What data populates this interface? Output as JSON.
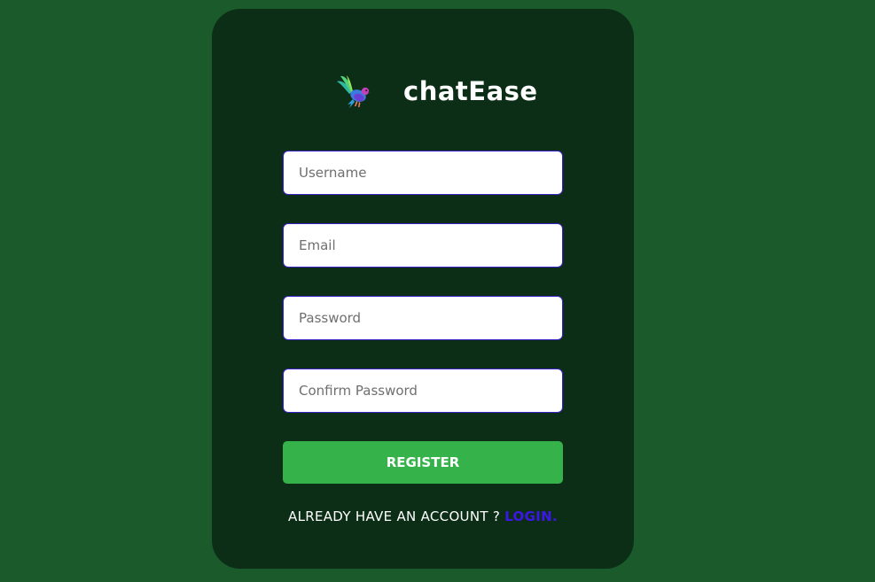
{
  "app": {
    "brand_name": "chatEase",
    "logo_icon": "hummingbird-logo-icon"
  },
  "form": {
    "username_placeholder": "Username",
    "email_placeholder": "Email",
    "password_placeholder": "Password",
    "confirm_password_placeholder": "Confirm Password",
    "register_label": "REGISTER"
  },
  "footer": {
    "prompt": "ALREADY HAVE AN ACCOUNT ?",
    "login_label": "LOGIN."
  },
  "colors": {
    "page_background": "#1b5b2b",
    "card_background": "#0c2e17",
    "input_border": "#3b22c8",
    "register_button": "#35b34a",
    "login_link": "#3d16e8"
  }
}
